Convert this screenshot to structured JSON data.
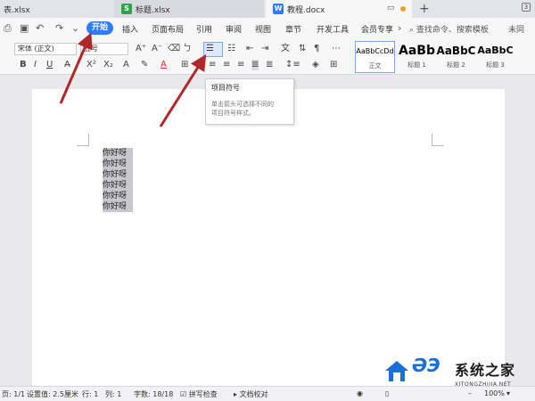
{
  "tabs": [
    {
      "label": "表.xlsx",
      "icon": "S"
    },
    {
      "label": "标题.xlsx",
      "icon": "S"
    },
    {
      "label": "教程.docx",
      "icon": "W"
    }
  ],
  "menu": {
    "items": [
      "开始",
      "插入",
      "页面布局",
      "引用",
      "审阅",
      "视图",
      "章节",
      "开发工具",
      "会员专享"
    ],
    "search": "查找命令、搜索模板",
    "share": "未同"
  },
  "ribbon": {
    "font": "宋体 (正文)",
    "size": "五号",
    "styles": [
      {
        "preview": "AaBbCcDd",
        "name": "正文"
      },
      {
        "preview": "AaBb",
        "name": "标题 1"
      },
      {
        "preview": "AaBbC",
        "name": "标题 2"
      },
      {
        "preview": "AaBbC",
        "name": "标题 3"
      }
    ]
  },
  "tooltip": {
    "title": "项目符号",
    "desc1": "单击箭头可选择不同的",
    "desc2": "项目符号样式。"
  },
  "document": {
    "paragraphs": [
      "你好呀",
      "你好呀",
      "你好呀",
      "你好呀",
      "你好呀",
      "你好呀"
    ]
  },
  "status": {
    "page": "页: 1/1",
    "setting": "设置值: 2.5厘米",
    "row": "行: 1",
    "col": "列: 1",
    "words": "字数: 18/18",
    "spellcheck": "拼写检查",
    "proofread": "文档校对",
    "zoom": "100%"
  },
  "watermark": {
    "cn": "系统之家",
    "url": "XITONGZHIJIA.NET"
  },
  "colors": {
    "accent": "#2f7cf6",
    "selection": "#c8c8cc",
    "arrow": "#b0282a"
  }
}
